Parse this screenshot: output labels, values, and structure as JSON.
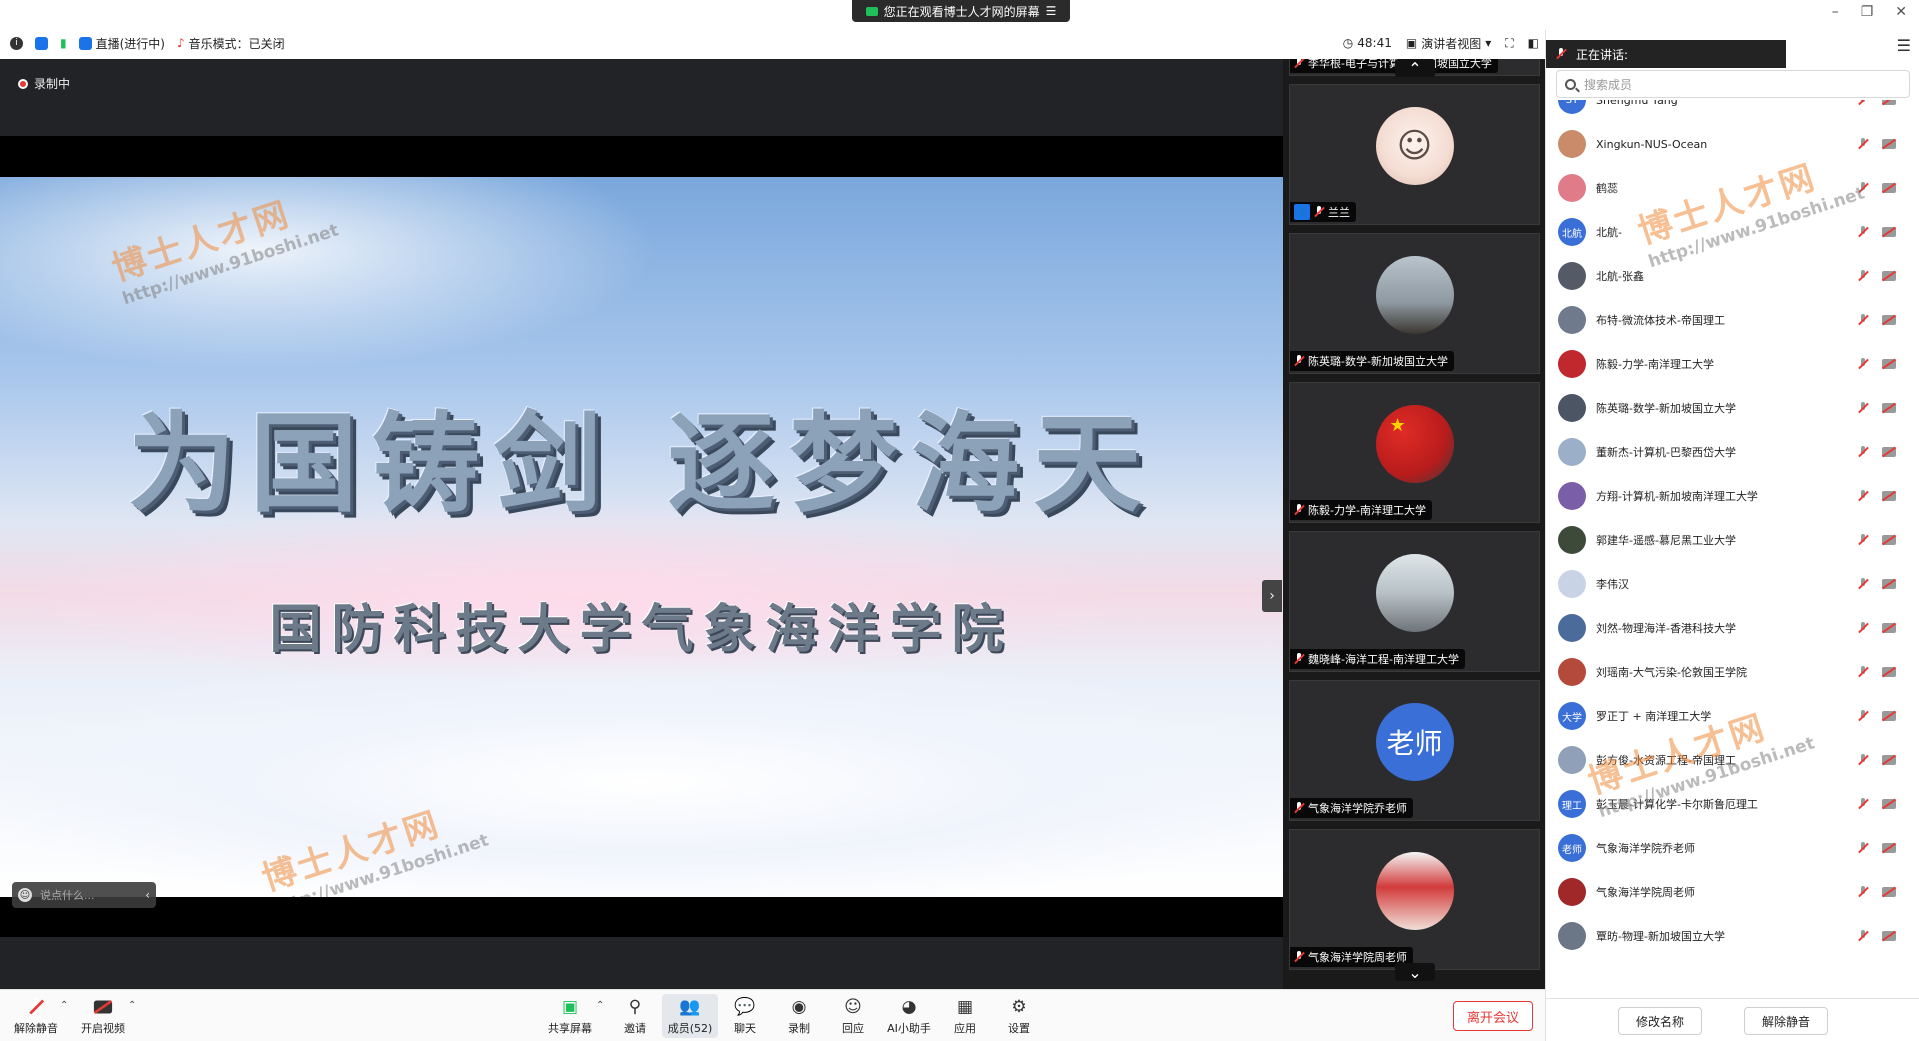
{
  "banner": {
    "text": "您正在观看博士人才网的屏幕"
  },
  "status_bar": {
    "live": "直播(进行中)",
    "music": "音乐模式：已关闭",
    "timer": "48:41",
    "view_mode": "演讲者视图"
  },
  "video": {
    "recording": "录制中",
    "slide_title": "为国铸剑 逐梦海天",
    "slide_subtitle": "国防科技大学气象海洋学院",
    "chat_placeholder": "说点什么...",
    "watermark_cn": "博士人才网",
    "watermark_url": "http://www.91boshi.net"
  },
  "gallery": {
    "tiles": [
      {
        "name": "李华根-电子与计算机-新加坡国立大学"
      },
      {
        "name": "兰兰"
      },
      {
        "name": "陈英璐-数学-新加坡国立大学"
      },
      {
        "name": "陈毅-力学-南洋理工大学"
      },
      {
        "name": "魏晓峰-海洋工程-南洋理工大学"
      },
      {
        "name": "气象海洋学院乔老师",
        "avatar_text": "老师"
      },
      {
        "name": "气象海洋学院周老师"
      }
    ]
  },
  "toolbar": {
    "unmute": "解除静音",
    "start_video": "开启视频",
    "share": "共享屏幕",
    "invite": "邀请",
    "members": "成员(52)",
    "chat": "聊天",
    "record": "录制",
    "react": "回应",
    "ai": "AI小助手",
    "apps": "应用",
    "settings": "设置",
    "leave": "离开会议"
  },
  "members_panel": {
    "speaking": "正在讲话:",
    "search_placeholder": "搜索成员",
    "rename": "修改名称",
    "unmute": "解除静音",
    "members": [
      {
        "name": "Shengmu Yang",
        "avatar": "SY",
        "color": "#3a6fd8"
      },
      {
        "name": "Xingkun-NUS-Ocean",
        "avatar": "",
        "color": "#c98b6a"
      },
      {
        "name": "鹤蕊",
        "avatar": "",
        "color": "#e07b8a"
      },
      {
        "name": "北航-",
        "avatar": "北航",
        "color": "#3a6fd8"
      },
      {
        "name": "北航-张鑫",
        "avatar": "",
        "color": "#555b66"
      },
      {
        "name": "布特-微流体技术-帝国理工",
        "avatar": "",
        "color": "#6f7a8c"
      },
      {
        "name": "陈毅-力学-南洋理工大学",
        "avatar": "",
        "color": "#c0282d"
      },
      {
        "name": "陈英璐-数学-新加坡国立大学",
        "avatar": "",
        "color": "#4c5563"
      },
      {
        "name": "董新杰-计算机-巴黎西岱大学",
        "avatar": "",
        "color": "#9bb0c8"
      },
      {
        "name": "方翔-计算机-新加坡南洋理工大学",
        "avatar": "",
        "color": "#7a5fa8"
      },
      {
        "name": "郭建华-遥感-慕尼黑工业大学",
        "avatar": "",
        "color": "#3d4a3a"
      },
      {
        "name": "李伟汉",
        "avatar": "",
        "color": "#c9d3e6"
      },
      {
        "name": "刘然-物理海洋-香港科技大学",
        "avatar": "",
        "color": "#4b6b9a"
      },
      {
        "name": "刘瑶南-大气污染-伦敦国王学院",
        "avatar": "",
        "color": "#b44a3a"
      },
      {
        "name": "罗正丁 + 南洋理工大学",
        "avatar": "大学",
        "color": "#3a6fd8"
      },
      {
        "name": "彭方俊-水资源工程-帝国理工",
        "avatar": "",
        "color": "#8fa0b8"
      },
      {
        "name": "彭玉晨-计算化学-卡尔斯鲁厄理工",
        "avatar": "理工",
        "color": "#3a6fd8"
      },
      {
        "name": "气象海洋学院乔老师",
        "avatar": "老师",
        "color": "#3a6fd8"
      },
      {
        "name": "气象海洋学院周老师",
        "avatar": "",
        "color": "#a02828"
      },
      {
        "name": "覃昉-物理-新加坡国立大学",
        "avatar": "",
        "color": "#6b7686"
      }
    ]
  }
}
